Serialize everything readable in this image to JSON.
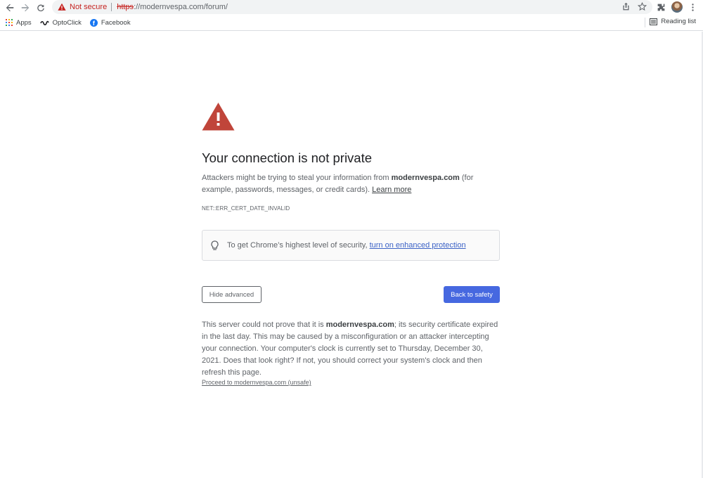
{
  "browser": {
    "security_label": "Not secure",
    "url_scheme": "https",
    "url_rest": "://modernvespa.com/forum/",
    "icons": [
      "back-arrow-icon",
      "forward-arrow-icon",
      "reload-icon",
      "warning-icon",
      "share-icon",
      "star-icon",
      "extensions-icon",
      "avatar",
      "menu-dots-icon"
    ]
  },
  "bookmarks": {
    "items": [
      {
        "label": "Apps",
        "icon": "apps-grid-icon"
      },
      {
        "label": "OptoClick",
        "icon": "opto-icon"
      },
      {
        "label": "Facebook",
        "icon": "facebook-icon"
      }
    ],
    "reading_list": "Reading list"
  },
  "interstitial": {
    "heading": "Your connection is not private",
    "para_prefix": "Attackers might be trying to steal your information from ",
    "domain": "modernvespa.com",
    "para_suffix": " (for example, passwords, messages, or credit cards). ",
    "learn_more": "Learn more",
    "error_code": "NET::ERR_CERT_DATE_INVALID",
    "enhanced_text": "To get Chrome’s highest level of security, ",
    "enhanced_link": "turn on enhanced protection",
    "hide_advanced": "Hide advanced",
    "back_to_safety": "Back to safety",
    "detail_prefix": "This server could not prove that it is ",
    "detail_suffix": "; its security certificate expired in the last day. This may be caused by a misconfiguration or an attacker intercepting your connection. Your computer's clock is currently set to Thursday, December 30, 2021. Does that look right? If not, you should correct your system's clock and then refresh this page.",
    "proceed_link": "Proceed to modernvespa.com (unsafe)"
  },
  "colors": {
    "danger": "#c5221f",
    "warning_triangle": "#c0453a",
    "primary_button": "#4668e0",
    "link_blue": "#3b62c6",
    "text_secondary": "#5f6368"
  }
}
